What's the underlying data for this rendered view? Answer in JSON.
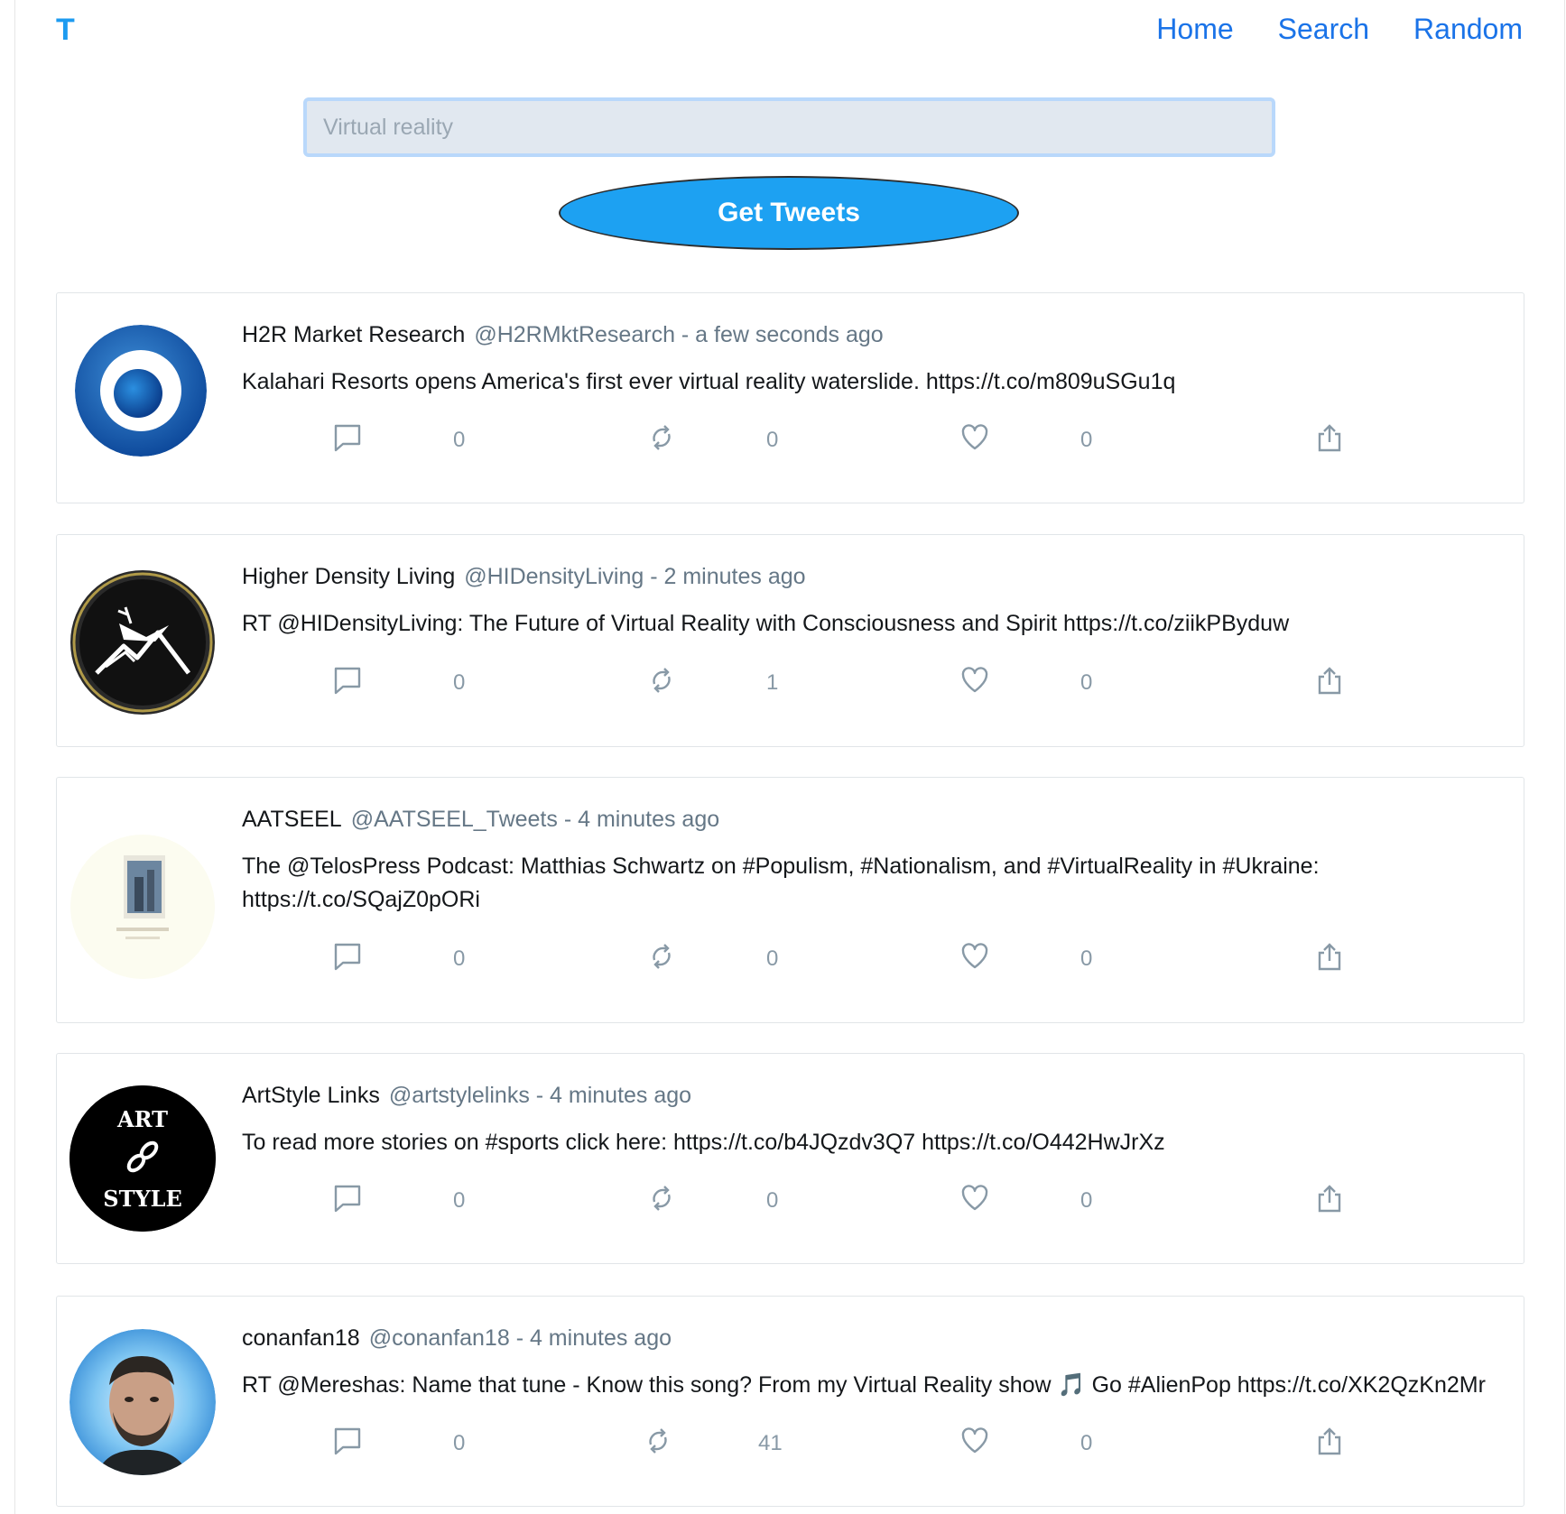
{
  "app": {
    "logo": "T"
  },
  "nav": {
    "items": [
      {
        "label": "Home"
      },
      {
        "label": "Search"
      },
      {
        "label": "Random"
      }
    ]
  },
  "search": {
    "value": "Virtual reality",
    "button_label": "Get Tweets"
  },
  "tweets": [
    {
      "name": "H2R Market Research",
      "meta": "@H2RMktResearch - a few seconds ago",
      "text": "Kalahari Resorts opens America's first ever virtual reality waterslide. https://t.co/m809uSGu1q",
      "replies": "0",
      "retweets": "0",
      "likes": "0"
    },
    {
      "name": "Higher Density Living",
      "meta": "@HIDensityLiving - 2 minutes ago",
      "text": "RT @HIDensityLiving: The Future of Virtual Reality with Consciousness and Spirit https://t.co/ziikPByduw",
      "replies": "0",
      "retweets": "1",
      "likes": "0"
    },
    {
      "name": "AATSEEL",
      "meta": "@AATSEEL_Tweets - 4 minutes ago",
      "text": "The @TelosPress Podcast: Matthias Schwartz on #Populism, #Nationalism, and #VirtualReality in #Ukraine: https://t.co/SQajZ0pORi",
      "replies": "0",
      "retweets": "0",
      "likes": "0"
    },
    {
      "name": "ArtStyle Links",
      "meta": "@artstylelinks - 4 minutes ago",
      "text": "To read more stories on #sports click here: https://t.co/b4JQzdv3Q7 https://t.co/O442HwJrXz",
      "replies": "0",
      "retweets": "0",
      "likes": "0",
      "avatar_text_top": "ART",
      "avatar_text_bottom": "STYLE"
    },
    {
      "name": "conanfan18",
      "meta": "@conanfan18 - 4 minutes ago",
      "text": "RT @Mereshas: Name that tune - Know this song? From my Virtual Reality show 🎵 Go #AlienPop https://t.co/XK2QzKn2Mr",
      "replies": "0",
      "retweets": "41",
      "likes": "0"
    }
  ]
}
